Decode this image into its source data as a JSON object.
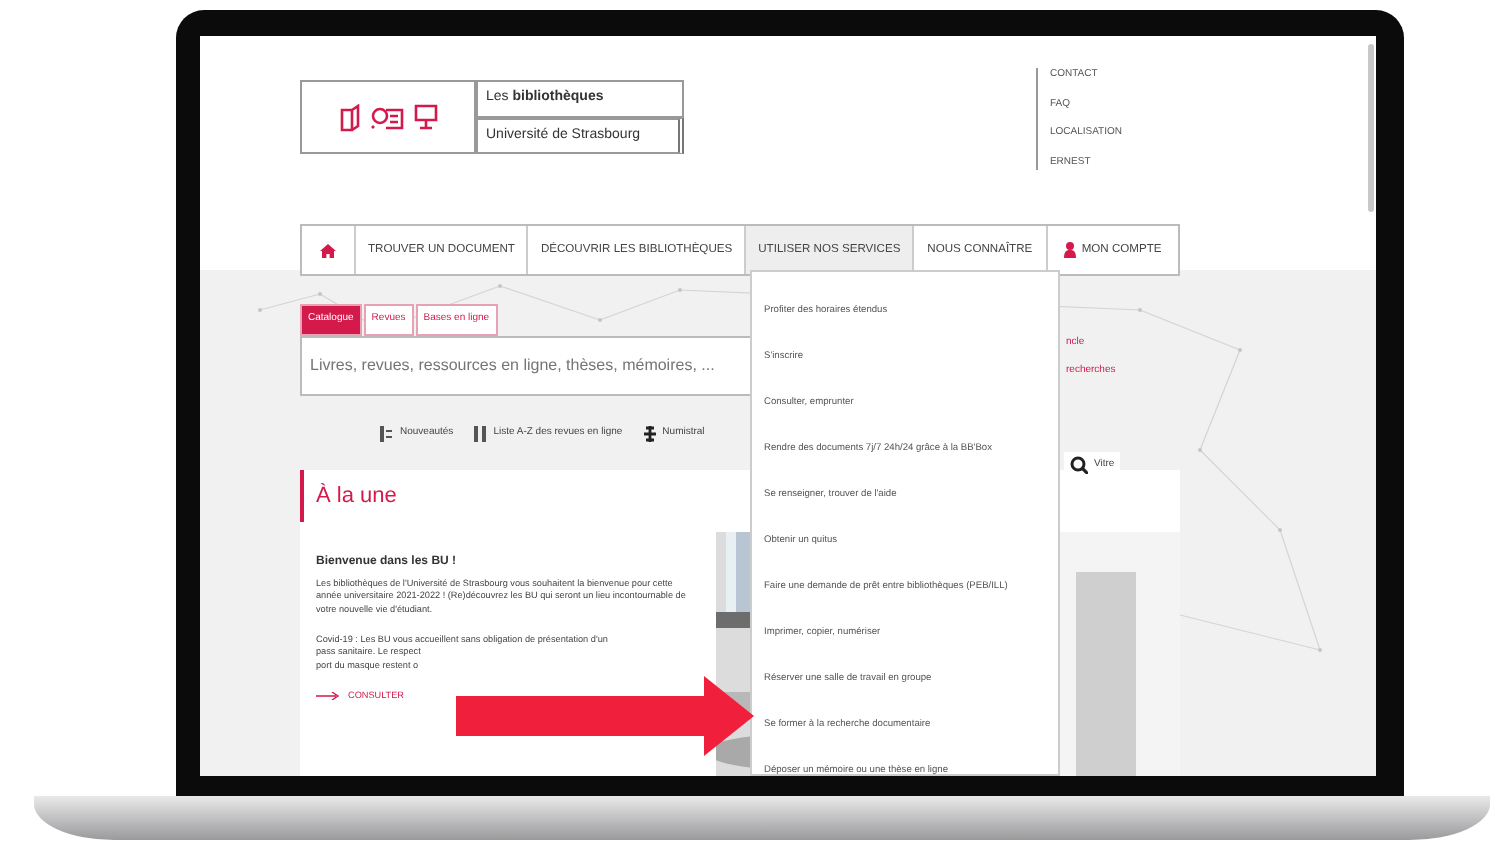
{
  "logo": {
    "line_1": "Les **bibliothèques**",
    "line_2": "Université de Strasbourg"
  },
  "top_links": [
    "CONTACT",
    "FAQ",
    "LOCALISATION",
    "ERNEST"
  ],
  "nav": [
    {
      "kind": "home",
      "selected": false
    },
    {
      "kind": "text",
      "label": "TROUVER UN DOCUMENT",
      "selected": false
    },
    {
      "kind": "text",
      "label": "DÉCOUVRIR LES BIBLIOTHÈQUES",
      "selected": false
    },
    {
      "kind": "text",
      "label": "UTILISER NOS SERVICES",
      "selected": true
    },
    {
      "kind": "text",
      "label": "NOUS CONNAÎTRE",
      "selected": false
    },
    {
      "kind": "account",
      "label": "MON COMPTE",
      "selected": false
    }
  ],
  "search": {
    "tabs": [
      {
        "label": "Catalogue",
        "selected": true
      },
      {
        "label": "Revues",
        "selected": false
      },
      {
        "label": "Bases en ligne",
        "selected": false
      }
    ],
    "placeholder": "Livres, revues, ressources en ligne, thèses, mémoires, ..."
  },
  "quick_links": [
    {
      "kind": "list",
      "label": "Nouveautés"
    },
    {
      "kind": "az",
      "label": "Liste A-Z des revues en ligne"
    },
    {
      "kind": "gallica",
      "label": "Numistral"
    }
  ],
  "side_links": [
    "ncle",
    "recherches"
  ],
  "tool_link": "Vitre",
  "featured": {
    "heading": "À la une",
    "title": "Bienvenue dans les BU !",
    "text": "Les bibliothèques de l'Université de Strasbourg vous souhaitent la bienvenue pour cette année universitaire 2021-2022 ! (Re)découvrez les BU qui seront un lieu incontournable de votre nouvelle vie d'étudiant.",
    "covid_lines": [
      "Covid-19 : Les BU vous accueillent sans obligation de présentation d'un",
      "pass sanitaire. Le respect",
      "port du masque restent o"
    ],
    "link": "CONSULTER"
  },
  "dropdown": [
    "Profiter des horaires étendus",
    "S'inscrire",
    "Consulter, emprunter",
    "Rendre des documents 7j/7 24h/24 grâce à la BB'Box",
    "Se renseigner, trouver de l'aide",
    "Obtenir un quitus",
    "Faire une demande de prêt entre bibliothèques (PEB/ILL)",
    "Imprimer, copier, numériser",
    "Réserver une salle de travail en groupe",
    "Se former à la recherche documentaire",
    "Déposer un mémoire ou une thèse en ligne"
  ]
}
